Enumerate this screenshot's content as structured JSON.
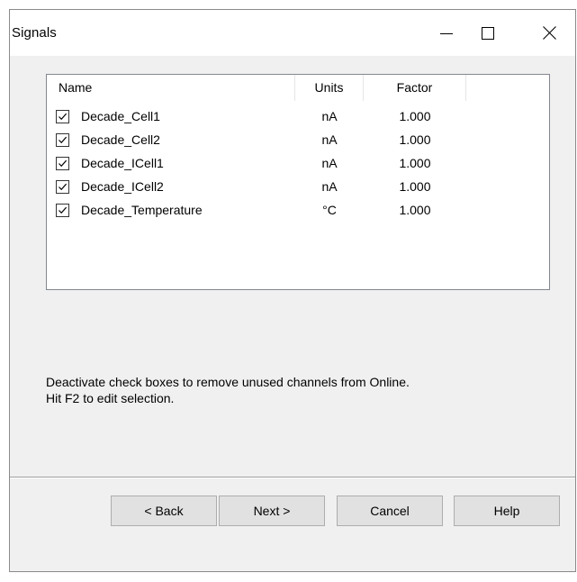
{
  "window": {
    "title": "Signals",
    "minimize_glyph": "—",
    "maximize_glyph": "☐",
    "close_glyph": "✕"
  },
  "list": {
    "headers": {
      "name": "Name",
      "units": "Units",
      "factor": "Factor"
    },
    "rows": [
      {
        "checked": true,
        "name": "Decade_Cell1",
        "units": "nA",
        "factor": "1.000"
      },
      {
        "checked": true,
        "name": "Decade_Cell2",
        "units": "nA",
        "factor": "1.000"
      },
      {
        "checked": true,
        "name": "Decade_ICell1",
        "units": "nA",
        "factor": "1.000"
      },
      {
        "checked": true,
        "name": "Decade_ICell2",
        "units": "nA",
        "factor": "1.000"
      },
      {
        "checked": true,
        "name": "Decade_Temperature",
        "units": "°C",
        "factor": "1.000"
      }
    ]
  },
  "info": {
    "line1": "Deactivate check boxes to remove unused channels from Online.",
    "line2": "Hit F2 to edit selection."
  },
  "buttons": {
    "back": "< Back",
    "next": "Next >",
    "cancel": "Cancel",
    "help": "Help"
  },
  "icons": {
    "minimize": "minimize-icon",
    "maximize": "maximize-icon",
    "close": "close-icon",
    "checkbox": "checkmark-icon"
  },
  "colors": {
    "window_bg": "#f0f0f0",
    "button_bg": "#e1e1e1",
    "button_border": "#adadad",
    "list_border": "#828790"
  }
}
